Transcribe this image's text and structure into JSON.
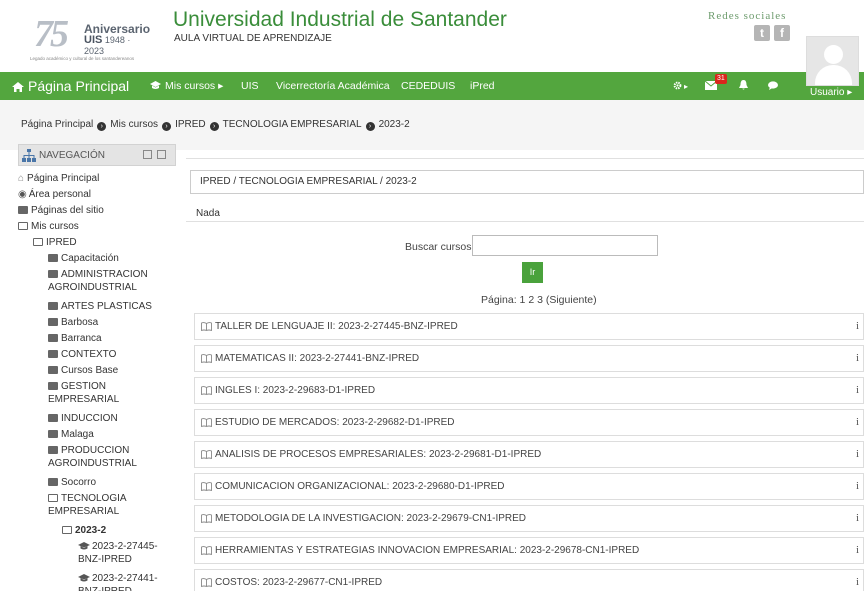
{
  "header": {
    "logo": {
      "number": "75",
      "aniversario": "Aniversario",
      "uis": "UIS",
      "years": "1948 · 2023",
      "legado": "Legado académico y cultural de los santandereanos"
    },
    "title": "Universidad Industrial de Santander",
    "subtitle": "AULA VIRTUAL DE APRENDIZAJE",
    "redes": "Redes sociales",
    "social": {
      "twitter": "t",
      "facebook": "f"
    }
  },
  "navbar": {
    "brand": "Página Principal",
    "items": [
      "Mis cursos ▸",
      "UIS",
      "Vicerrectoría Académica",
      "CEDEDUIS",
      "iPred"
    ],
    "settings": "▸",
    "messages_badge": "31",
    "user": "Usuario ▸"
  },
  "breadcrumb": [
    "Página Principal",
    "Mis cursos",
    "IPRED",
    "TECNOLOGIA EMPRESARIAL",
    "2023-2"
  ],
  "sidebar": {
    "title": "NAVEGACIÓN",
    "items": [
      "Página Principal",
      "Área personal",
      "Páginas del sitio",
      "Mis cursos",
      "IPRED",
      "Capacitación",
      "ADMINISTRACION AGROINDUSTRIAL",
      "ARTES PLASTICAS",
      "Barbosa",
      "Barranca",
      "CONTEXTO",
      "Cursos Base",
      "GESTION EMPRESARIAL",
      "INDUCCION",
      "Malaga",
      "PRODUCCION AGROINDUSTRIAL",
      "Socorro",
      "TECNOLOGIA EMPRESARIAL",
      "2023-2",
      "2023-2-27445-BNZ-IPRED",
      "2023-2-27441-BNZ-IPRED"
    ]
  },
  "main": {
    "path": "IPRED / TECNOLOGIA EMPRESARIAL / 2023-2",
    "nada": "Nada",
    "search_label": "Buscar cursos:",
    "search_value": "",
    "go_label": "Ir",
    "paging_prefix": "Página:",
    "pages": [
      "1",
      "2",
      "3",
      "(Siguiente)"
    ],
    "info_glyph": "i",
    "courses": [
      "TALLER DE LENGUAJE II: 2023-2-27445-BNZ-IPRED",
      "MATEMATICAS II: 2023-2-27441-BNZ-IPRED",
      "INGLES I: 2023-2-29683-D1-IPRED",
      "ESTUDIO DE MERCADOS: 2023-2-29682-D1-IPRED",
      "ANALISIS DE PROCESOS EMPRESARIALES: 2023-2-29681-D1-IPRED",
      "COMUNICACION ORGANIZACIONAL: 2023-2-29680-D1-IPRED",
      "METODOLOGIA DE LA INVESTIGACION: 2023-2-29679-CN1-IPRED",
      "HERRAMIENTAS Y ESTRATEGIAS INNOVACION EMPRESARIAL: 2023-2-29678-CN1-IPRED",
      "COSTOS: 2023-2-29677-CN1-IPRED"
    ]
  },
  "colors": {
    "brand_green": "#53a63e",
    "title_green": "#3a8d3a",
    "badge_red": "#d9261c"
  }
}
